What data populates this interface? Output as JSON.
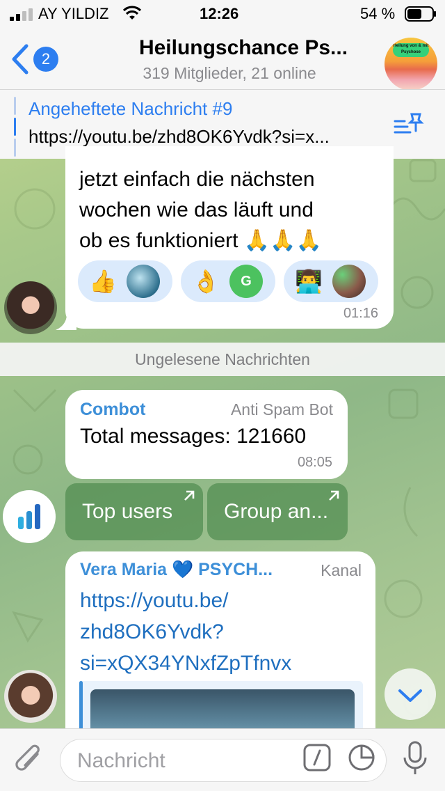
{
  "status_bar": {
    "carrier": "AY YILDIZ",
    "time": "12:26",
    "battery": "54 %"
  },
  "header": {
    "back_badge": "2",
    "title": "Heilungschance Ps...",
    "subtitle": "319 Mitglieder, 21 online",
    "avatar_logo_text": "Heilung von & mit Psychose"
  },
  "pinned": {
    "title": "Angeheftete Nachricht #9",
    "text": "https://youtu.be/zhd8OK6Yvdk?si=x..."
  },
  "messages": {
    "m1": {
      "lines": [
        "jetzt einfach die nächsten",
        "wochen wie das läuft und",
        "ob es funktioniert 🙏🙏🙏"
      ],
      "reactions": [
        {
          "emoji": "👍"
        },
        {
          "emoji": "👌",
          "avatar_letter": "G"
        },
        {
          "emoji": "👨‍💻"
        }
      ],
      "time": "01:16"
    },
    "unread_label": "Ungelesene Nachrichten",
    "m2": {
      "sender": "Combot",
      "tag": "Anti Spam Bot",
      "body": "Total messages: 121660",
      "time": "08:05"
    },
    "buttons": [
      "Top users",
      "Group an..."
    ],
    "m3": {
      "sender": "Vera Maria 💙 PSYCH...",
      "tag": "Kanal",
      "link_lines": [
        "https://youtu.be/",
        "zhd8OK6Yvdk?",
        "si=xQX34YNxfZpTfnvx"
      ]
    }
  },
  "input": {
    "placeholder": "Nachricht"
  },
  "colors": {
    "accent": "#2d7ef0",
    "link": "#1f6fbf",
    "sender": "#3d8fd8",
    "keyboard_button": "#508c50"
  }
}
